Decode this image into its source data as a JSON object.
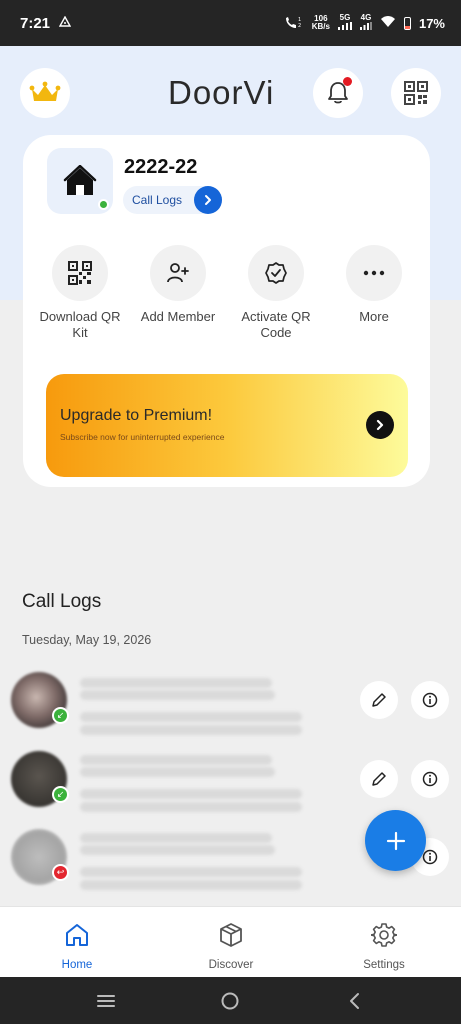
{
  "status_bar": {
    "time": "7:21",
    "call_sim_label": "1\n2",
    "speed_value": "106",
    "speed_unit": "KB/s",
    "network_5g": "5G",
    "network_4g": "4G",
    "battery": "17%"
  },
  "header": {
    "logo": "DoorVi",
    "has_notification": true
  },
  "home": {
    "name": "2222-22",
    "call_logs_label": "Call Logs",
    "online": true
  },
  "actions": [
    {
      "label": "Download QR Kit",
      "icon": "qr-code-icon"
    },
    {
      "label": "Add Member",
      "icon": "add-person-icon"
    },
    {
      "label": "Activate QR Code",
      "icon": "badge-check-icon"
    },
    {
      "label": "More",
      "icon": "more-dots-icon"
    }
  ],
  "premium": {
    "title": "Upgrade to Premium!",
    "subtitle": "Subscribe now for uninterrupted experience"
  },
  "call_logs": {
    "title": "Call Logs",
    "date": "Tuesday, May 19, 2026",
    "entries": [
      {
        "direction": "incoming",
        "status_color": "#3cb23c"
      },
      {
        "direction": "incoming",
        "status_color": "#3cb23c"
      },
      {
        "direction": "missed",
        "status_color": "#e3262f"
      }
    ]
  },
  "bottom_nav": {
    "items": [
      {
        "label": "Home",
        "icon": "home-icon",
        "active": true
      },
      {
        "label": "Discover",
        "icon": "cube-icon",
        "active": false
      },
      {
        "label": "Settings",
        "icon": "gear-icon",
        "active": false
      }
    ]
  },
  "colors": {
    "accent": "#1565d8",
    "fab": "#1a7de6",
    "hero_bg": "#e6eefb",
    "premium_start": "#f79a0d",
    "premium_end": "#fdfb9b"
  }
}
